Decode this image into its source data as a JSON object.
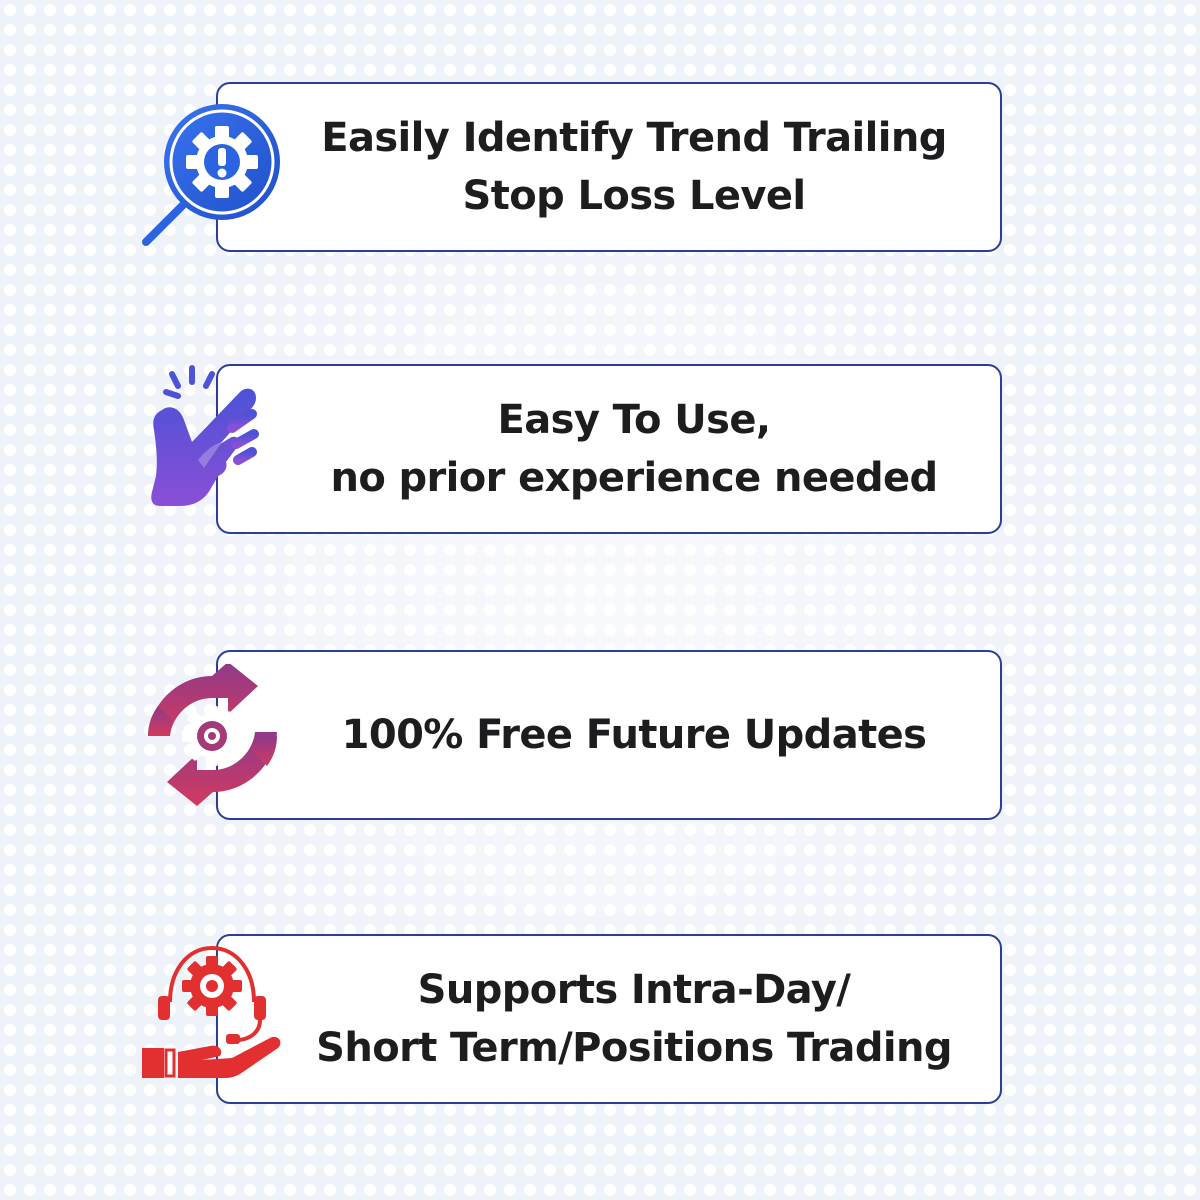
{
  "features": [
    {
      "icon": "gear-alert-magnifier-icon",
      "color": "#2c63e0",
      "lines": [
        "Easily Identify Trend Trailing",
        "Stop Loss Level"
      ]
    },
    {
      "icon": "tap-hand-icon",
      "color": "#6a4fd8",
      "lines": [
        "Easy To Use,",
        "no prior experience needed"
      ]
    },
    {
      "icon": "gear-refresh-icon",
      "color": "#b43a6e",
      "lines": [
        "100% Free Future Updates"
      ]
    },
    {
      "icon": "gear-headset-hand-icon",
      "color": "#e1302f",
      "lines": [
        "Supports Intra-Day/",
        "Short Term/Positions Trading"
      ]
    }
  ],
  "colors": {
    "card_border": "#2d3f94",
    "text": "#1d1d1f",
    "background": "#eef2f9"
  }
}
